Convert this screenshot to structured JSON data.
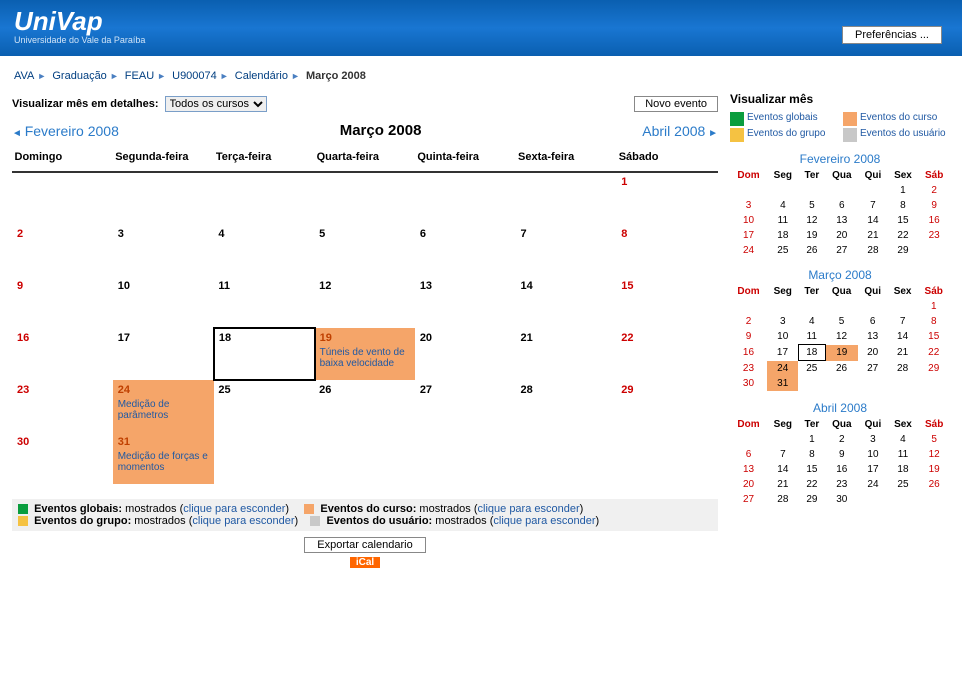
{
  "header": {
    "logo": "UniVap",
    "logo_sub": "Universidade do Vale da Paraíba",
    "prefs": "Preferências ..."
  },
  "breadcrumb": [
    "AVA",
    "Graduação",
    "FEAU",
    "U900074",
    "Calendário",
    "Março 2008"
  ],
  "controls": {
    "label": "Visualizar mês em detalhes:",
    "select_value": "Todos os cursos",
    "novo": "Novo evento"
  },
  "nav": {
    "prev": "Fevereiro 2008",
    "title": "Março 2008",
    "next": "Abril 2008"
  },
  "weekdays": [
    "Domingo",
    "Segunda-feira",
    "Terça-feira",
    "Quarta-feira",
    "Quinta-feira",
    "Sexta-feira",
    "Sábado"
  ],
  "events": {
    "d19": "Túneis de vento de baixa velocidade",
    "d24": "Medição de parâmetros",
    "d31": "Medição de forças e momentos"
  },
  "legend": {
    "global_lbl": "Eventos globais:",
    "global_state": "mostrados",
    "hide": "clique para esconder",
    "course_lbl": "Eventos do curso:",
    "group_lbl": "Eventos do grupo:",
    "user_lbl": "Eventos do usuário:"
  },
  "export": {
    "btn": "Exportar calendario",
    "ical": "iCal"
  },
  "side": {
    "title": "Visualizar mês",
    "keys": {
      "global": "Eventos globais",
      "course": "Eventos do curso",
      "group": "Eventos do grupo",
      "user": "Eventos do usuário"
    }
  },
  "mini_weekdays": [
    "Dom",
    "Seg",
    "Ter",
    "Qua",
    "Qui",
    "Sex",
    "Sáb"
  ],
  "mini": {
    "feb": {
      "title": "Fevereiro 2008",
      "start": 5,
      "days": 29
    },
    "mar": {
      "title": "Março 2008",
      "start": 6,
      "days": 31
    },
    "apr": {
      "title": "Abril 2008",
      "start": 2,
      "days": 30
    }
  }
}
